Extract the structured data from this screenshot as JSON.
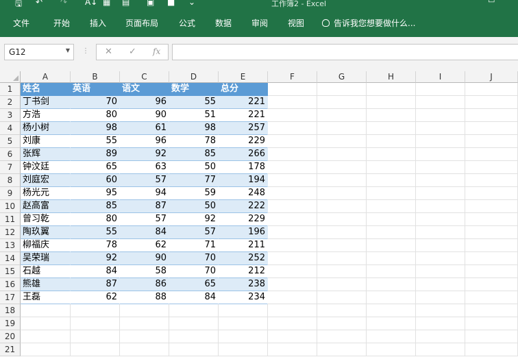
{
  "window": {
    "title": "工作簿2 - Excel"
  },
  "ribbon": {
    "tabs": [
      "文件",
      "开始",
      "插入",
      "页面布局",
      "公式",
      "数据",
      "审阅",
      "视图"
    ],
    "tell_me": "告诉我您想要做什么..."
  },
  "formula_bar": {
    "name_box": "G12",
    "cancel": "✕",
    "enter": "✓",
    "fx": "fx",
    "formula": ""
  },
  "columns": [
    "A",
    "B",
    "C",
    "D",
    "E",
    "F",
    "G",
    "H",
    "I",
    "J"
  ],
  "rows": [
    "1",
    "2",
    "3",
    "4",
    "5",
    "6",
    "7",
    "8",
    "9",
    "10",
    "11",
    "12",
    "13",
    "14",
    "15",
    "16",
    "17",
    "18",
    "19",
    "20",
    "21"
  ],
  "table": {
    "headers": [
      "姓名",
      "英语",
      "语文",
      "数学",
      "总分"
    ],
    "data": [
      [
        "丁书剑",
        "70",
        "96",
        "55",
        "221"
      ],
      [
        "方浩",
        "80",
        "90",
        "51",
        "221"
      ],
      [
        "杨小树",
        "98",
        "61",
        "98",
        "257"
      ],
      [
        "刘康",
        "55",
        "96",
        "78",
        "229"
      ],
      [
        "张辉",
        "89",
        "92",
        "85",
        "266"
      ],
      [
        "钟汶廷",
        "65",
        "63",
        "50",
        "178"
      ],
      [
        "刘庭宏",
        "60",
        "57",
        "77",
        "194"
      ],
      [
        "杨光元",
        "95",
        "94",
        "59",
        "248"
      ],
      [
        "赵高富",
        "85",
        "87",
        "50",
        "222"
      ],
      [
        "曾习乾",
        "80",
        "57",
        "92",
        "229"
      ],
      [
        "陶玖翼",
        "55",
        "84",
        "57",
        "196"
      ],
      [
        "柳福庆",
        "78",
        "62",
        "71",
        "211"
      ],
      [
        "吴荣瑞",
        "92",
        "90",
        "70",
        "252"
      ],
      [
        "石越",
        "84",
        "58",
        "70",
        "212"
      ],
      [
        "熊雄",
        "87",
        "86",
        "65",
        "238"
      ],
      [
        "王磊",
        "62",
        "88",
        "84",
        "234"
      ]
    ]
  },
  "colors": {
    "ribbon": "#217346",
    "table_header": "#5b9bd5",
    "table_band": "#ddebf7"
  }
}
